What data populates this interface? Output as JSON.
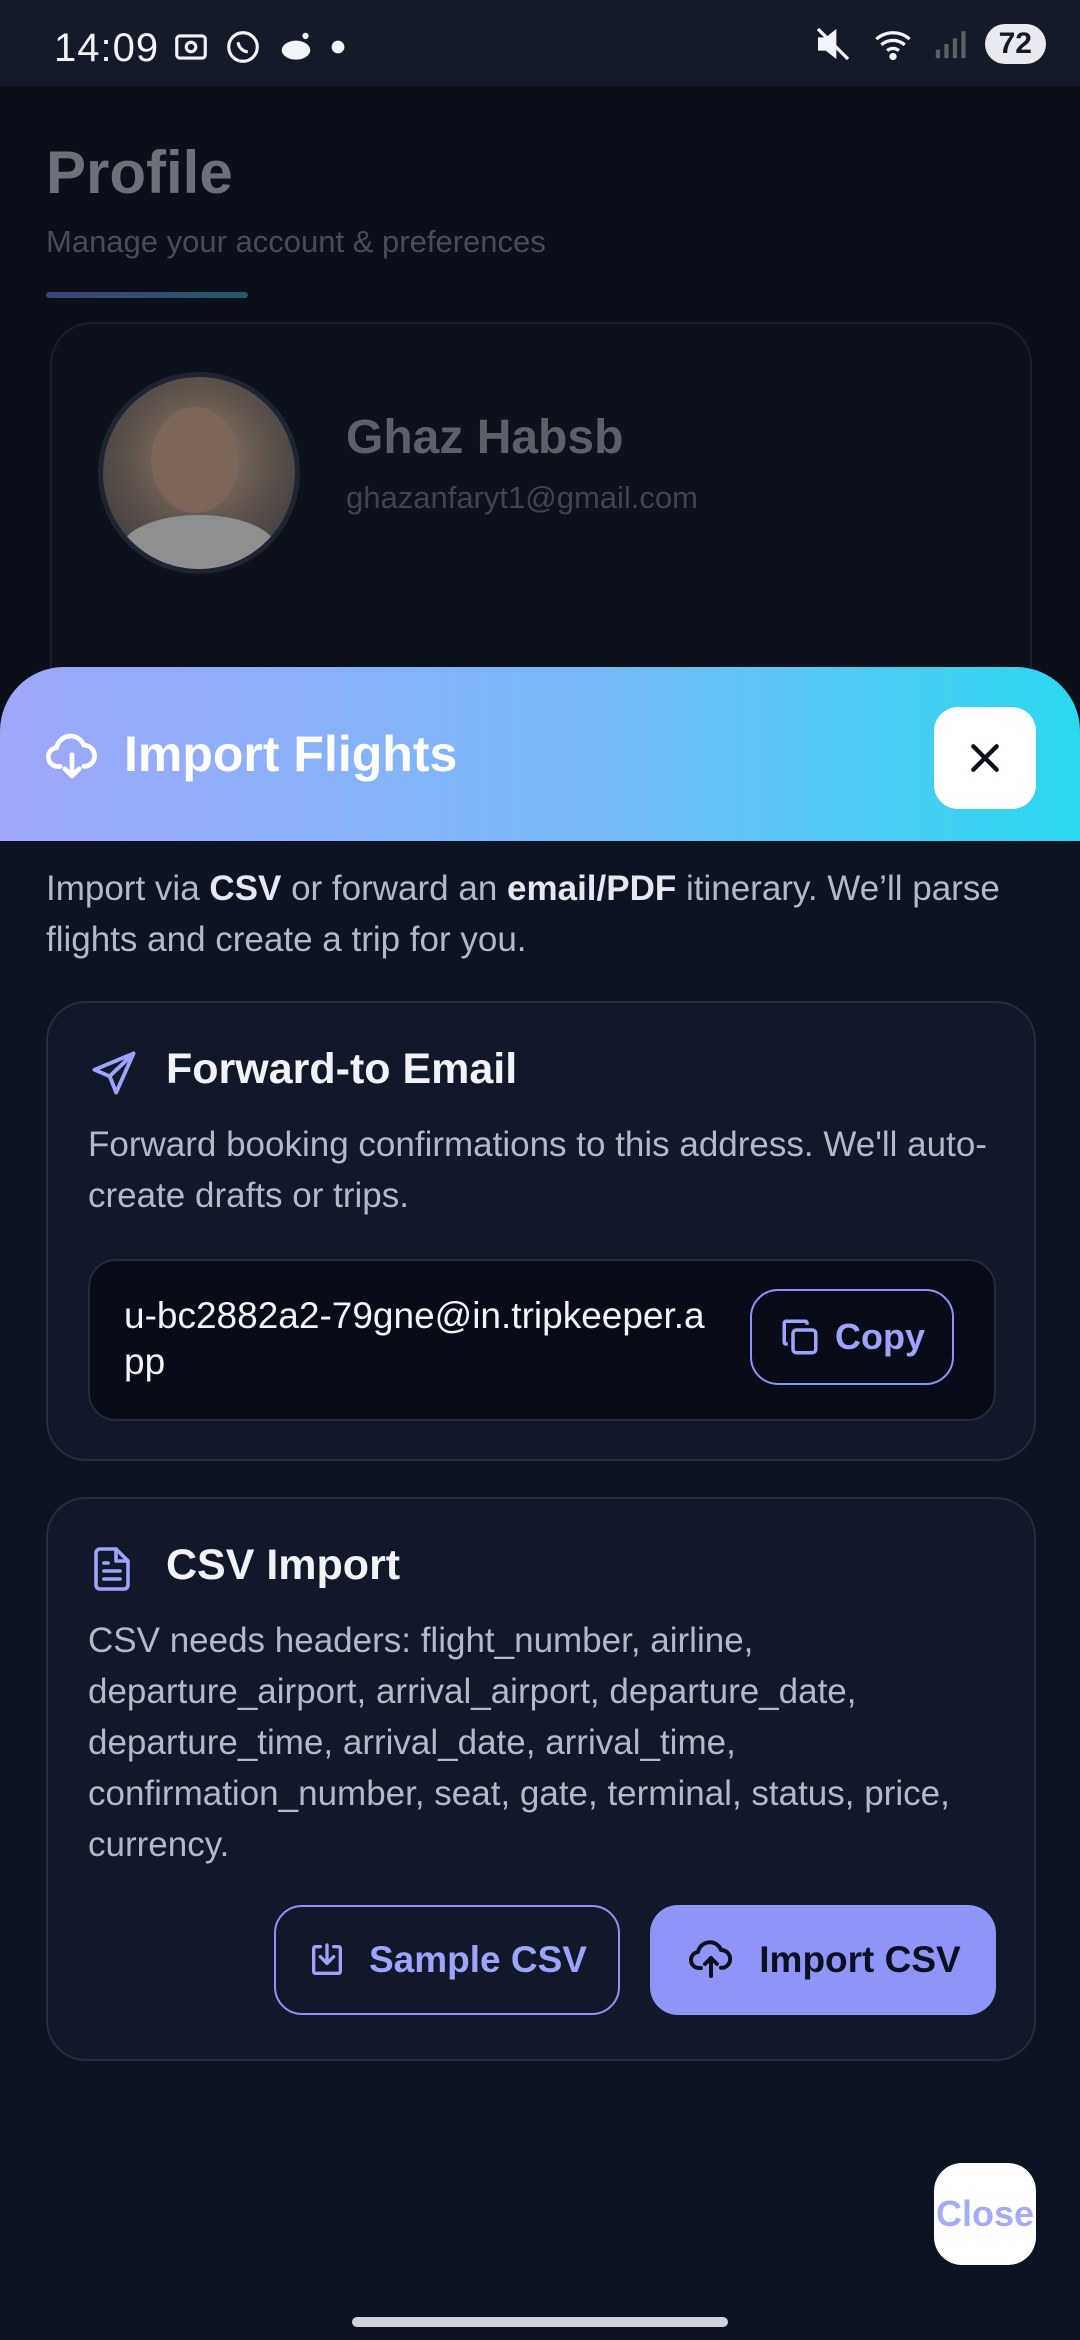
{
  "status_bar": {
    "time": "14:09",
    "battery": "72"
  },
  "background_page": {
    "title": "Profile",
    "subtitle": "Manage your account & preferences",
    "user_name": "Ghaz Habsb",
    "user_email": "ghazanfaryt1@gmail.com"
  },
  "sheet": {
    "title": "Import Flights",
    "intro": {
      "part1": "Import via ",
      "csv": "CSV",
      "part2": " or forward an ",
      "email_pdf": "email/PDF",
      "part3": " itinerary. We’ll parse flights and create a trip for you."
    },
    "forward": {
      "title": "Forward-to Email",
      "description": "Forward booking confirmations to this address. We'll auto-create drafts or trips.",
      "address": "u-bc2882a2-79gne@in.tripkeeper.app",
      "copy_label": "Copy"
    },
    "csv": {
      "title": "CSV Import",
      "description": "CSV needs headers: flight_number, airline, departure_airport, arrival_airport, departure_date, departure_time, arrival_date, arrival_time, confirmation_number, seat, gate, terminal, status, price, currency.",
      "sample_label": "Sample CSV",
      "import_label": "Import CSV"
    },
    "close_label": "Close"
  },
  "colors": {
    "accent": "#8e95f7",
    "header_gradient_start": "#a0a7fb",
    "header_gradient_end": "#2bd8f0",
    "sheet_background": "#0d1322"
  }
}
